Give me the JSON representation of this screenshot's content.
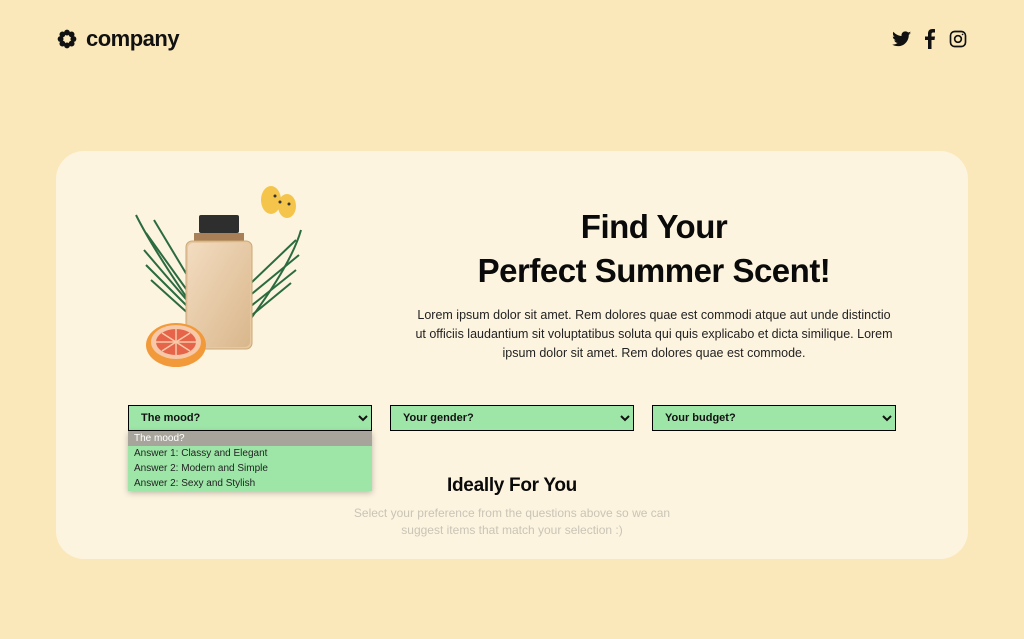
{
  "header": {
    "brand": "company"
  },
  "hero": {
    "title_line1": "Find Your",
    "title_line2": "Perfect Summer Scent!",
    "body": "Lorem ipsum dolor sit amet. Rem dolores quae est commodi atque aut unde distinctio ut officiis laudantium sit voluptatibus soluta qui quis explicabo et dicta similique. Lorem ipsum dolor sit amet. Rem dolores quae est commode."
  },
  "selects": {
    "mood": {
      "label": "The mood?",
      "options": [
        "The mood?",
        "Answer 1: Classy and Elegant",
        "Answer 2: Modern and Simple",
        "Answer 2: Sexy and Stylish"
      ]
    },
    "gender": {
      "label": "Your gender?"
    },
    "budget": {
      "label": "Your budget?"
    }
  },
  "results": {
    "heading": "Ideally For You",
    "hint_line1": "Select your preference from the questions above so we can",
    "hint_line2": "suggest items that match your selection :)"
  }
}
